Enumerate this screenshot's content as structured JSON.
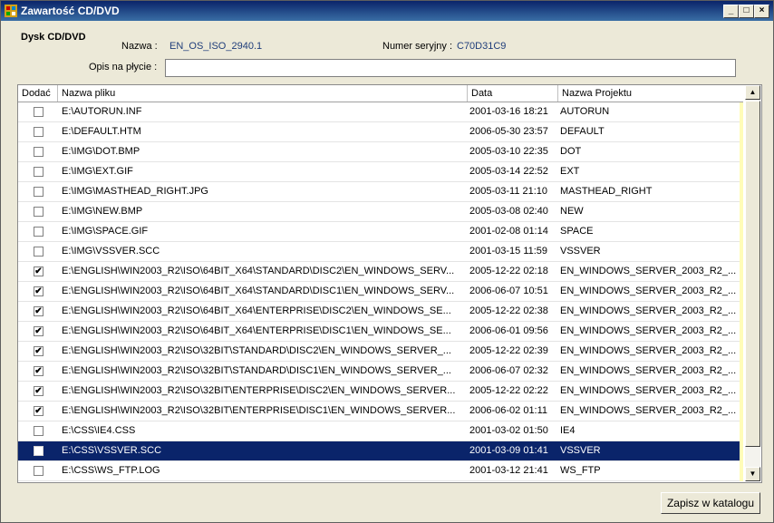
{
  "window": {
    "title": "Zawartość CD/DVD",
    "min": "_",
    "max": "□",
    "close": "×"
  },
  "header": {
    "title": "Dysk CD/DVD",
    "name_label": "Nazwa :",
    "name_value": "EN_OS_ISO_2940.1",
    "serial_label": "Numer seryjny :",
    "serial_value": "C70D31C9",
    "desc_label": "Opis na płycie :",
    "desc_value": ""
  },
  "grid": {
    "columns": [
      "Dodać",
      "Nazwa pliku",
      "Data",
      "Nazwa Projektu"
    ],
    "rows": [
      {
        "checked": false,
        "file": "E:\\AUTORUN.INF",
        "date": "2001-03-16 18:21",
        "project": "AUTORUN"
      },
      {
        "checked": false,
        "file": "E:\\DEFAULT.HTM",
        "date": "2006-05-30 23:57",
        "project": "DEFAULT"
      },
      {
        "checked": false,
        "file": "E:\\IMG\\DOT.BMP",
        "date": "2005-03-10 22:35",
        "project": "DOT"
      },
      {
        "checked": false,
        "file": "E:\\IMG\\EXT.GIF",
        "date": "2005-03-14 22:52",
        "project": "EXT"
      },
      {
        "checked": false,
        "file": "E:\\IMG\\MASTHEAD_RIGHT.JPG",
        "date": "2005-03-11 21:10",
        "project": "MASTHEAD_RIGHT"
      },
      {
        "checked": false,
        "file": "E:\\IMG\\NEW.BMP",
        "date": "2005-03-08 02:40",
        "project": "NEW"
      },
      {
        "checked": false,
        "file": "E:\\IMG\\SPACE.GIF",
        "date": "2001-02-08 01:14",
        "project": "SPACE"
      },
      {
        "checked": false,
        "file": "E:\\IMG\\VSSVER.SCC",
        "date": "2001-03-15 11:59",
        "project": "VSSVER"
      },
      {
        "checked": true,
        "file": "E:\\ENGLISH\\WIN2003_R2\\ISO\\64BIT_X64\\STANDARD\\DISC2\\EN_WINDOWS_SERV...",
        "date": "2005-12-22 02:18",
        "project": "EN_WINDOWS_SERVER_2003_R2_..."
      },
      {
        "checked": true,
        "file": "E:\\ENGLISH\\WIN2003_R2\\ISO\\64BIT_X64\\STANDARD\\DISC1\\EN_WINDOWS_SERV...",
        "date": "2006-06-07 10:51",
        "project": "EN_WINDOWS_SERVER_2003_R2_..."
      },
      {
        "checked": true,
        "file": "E:\\ENGLISH\\WIN2003_R2\\ISO\\64BIT_X64\\ENTERPRISE\\DISC2\\EN_WINDOWS_SE...",
        "date": "2005-12-22 02:38",
        "project": "EN_WINDOWS_SERVER_2003_R2_..."
      },
      {
        "checked": true,
        "file": "E:\\ENGLISH\\WIN2003_R2\\ISO\\64BIT_X64\\ENTERPRISE\\DISC1\\EN_WINDOWS_SE...",
        "date": "2006-06-01 09:56",
        "project": "EN_WINDOWS_SERVER_2003_R2_..."
      },
      {
        "checked": true,
        "file": "E:\\ENGLISH\\WIN2003_R2\\ISO\\32BIT\\STANDARD\\DISC2\\EN_WINDOWS_SERVER_...",
        "date": "2005-12-22 02:39",
        "project": "EN_WINDOWS_SERVER_2003_R2_..."
      },
      {
        "checked": true,
        "file": "E:\\ENGLISH\\WIN2003_R2\\ISO\\32BIT\\STANDARD\\DISC1\\EN_WINDOWS_SERVER_...",
        "date": "2006-06-07 02:32",
        "project": "EN_WINDOWS_SERVER_2003_R2_..."
      },
      {
        "checked": true,
        "file": "E:\\ENGLISH\\WIN2003_R2\\ISO\\32BIT\\ENTERPRISE\\DISC2\\EN_WINDOWS_SERVER...",
        "date": "2005-12-22 02:22",
        "project": "EN_WINDOWS_SERVER_2003_R2_..."
      },
      {
        "checked": true,
        "file": "E:\\ENGLISH\\WIN2003_R2\\ISO\\32BIT\\ENTERPRISE\\DISC1\\EN_WINDOWS_SERVER...",
        "date": "2006-06-02 01:11",
        "project": "EN_WINDOWS_SERVER_2003_R2_..."
      },
      {
        "checked": false,
        "file": "E:\\CSS\\IE4.CSS",
        "date": "2001-03-02 01:50",
        "project": "IE4"
      },
      {
        "checked": false,
        "file": "E:\\CSS\\VSSVER.SCC",
        "date": "2001-03-09 01:41",
        "project": "VSSVER",
        "selected": true
      },
      {
        "checked": false,
        "file": "E:\\CSS\\WS_FTP.LOG",
        "date": "2001-03-12 21:41",
        "project": "WS_FTP"
      }
    ]
  },
  "footer": {
    "save_label": "Zapisz w katalogu"
  },
  "icons": {
    "app": "app-icon",
    "check": "✔",
    "up": "▲",
    "down": "▼"
  }
}
